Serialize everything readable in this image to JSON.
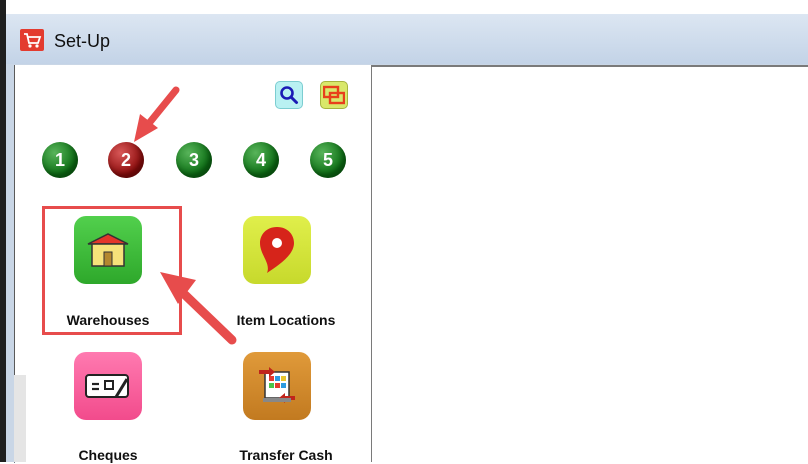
{
  "window": {
    "title": "Set-Up",
    "title_icon": "cart-icon"
  },
  "toolbar": {
    "search_icon": "search-icon",
    "window_icon": "windows-icon"
  },
  "pages": [
    {
      "label": "1",
      "selected": false
    },
    {
      "label": "2",
      "selected": true
    },
    {
      "label": "3",
      "selected": false
    },
    {
      "label": "4",
      "selected": false
    },
    {
      "label": "5",
      "selected": false
    }
  ],
  "tiles": {
    "warehouses": {
      "label": "Warehouses",
      "icon": "warehouse-icon",
      "color": "#3db93a"
    },
    "item_locations": {
      "label": "Item Locations",
      "icon": "location-pin-icon",
      "color": "#cfe03a"
    },
    "cheques": {
      "label": "Cheques",
      "icon": "cheque-icon",
      "color": "#ff5d9c"
    },
    "transfer_cash": {
      "label": "Transfer Cash",
      "icon": "transfer-cash-icon",
      "color": "#c88428"
    }
  },
  "colors": {
    "annotation": "#e74c4c",
    "page_green": "#0c6f14",
    "page_red": "#8d0c0c"
  }
}
